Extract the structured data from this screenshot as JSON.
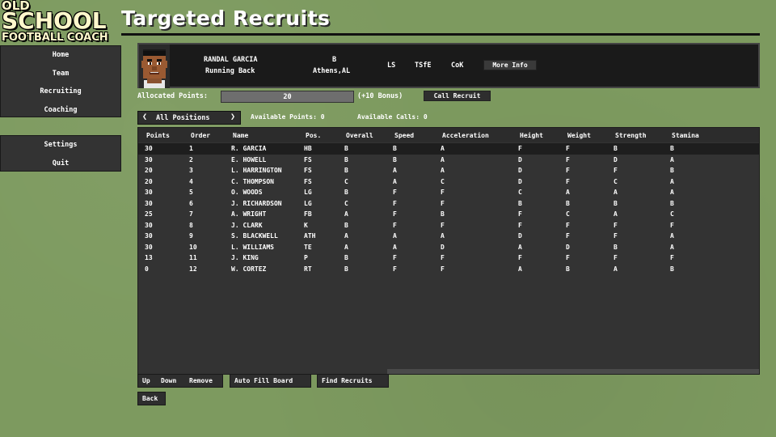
{
  "logo": {
    "line1": "OLD",
    "line2": "SCHOOL",
    "line3": "FOOTBALL COACH"
  },
  "sidebar": {
    "main_items": [
      {
        "label": "Home"
      },
      {
        "label": "Team"
      },
      {
        "label": "Recruiting"
      },
      {
        "label": "Coaching"
      }
    ],
    "bottom_items": [
      {
        "label": "Settings"
      },
      {
        "label": "Quit"
      }
    ]
  },
  "page": {
    "title": "Targeted Recruits"
  },
  "recruit": {
    "name": "RANDAL GARCIA",
    "position": "Running Back",
    "grade": "B",
    "hometown": "Athens,AL",
    "tag1": "LS",
    "tag2": "TSfE",
    "tag3": "CoK",
    "more_info_label": "More Info"
  },
  "allocation": {
    "label": "Allocated Points:",
    "value": "20",
    "bonus": "(+10 Bonus)",
    "call_button": "Call Recruit"
  },
  "filter": {
    "position_label": "All Positions",
    "available_points": "Available Points: 0",
    "available_calls": "Available Calls: 0"
  },
  "table": {
    "headers": [
      "Points",
      "Order",
      "Name",
      "Pos.",
      "Overall",
      "Speed",
      "Acceleration",
      "Height",
      "Weight",
      "Strength",
      "Stamina"
    ],
    "rows": [
      [
        "30",
        "1",
        "R. GARCIA",
        "HB",
        "B",
        "B",
        "A",
        "F",
        "F",
        "B",
        "B"
      ],
      [
        "30",
        "2",
        "E. HOWELL",
        "FS",
        "B",
        "B",
        "A",
        "D",
        "F",
        "D",
        "A"
      ],
      [
        "20",
        "3",
        "L. HARRINGTON",
        "FS",
        "B",
        "A",
        "A",
        "D",
        "F",
        "F",
        "B"
      ],
      [
        "20",
        "4",
        "C. THOMPSON",
        "FS",
        "C",
        "A",
        "C",
        "D",
        "F",
        "C",
        "A"
      ],
      [
        "30",
        "5",
        "O. WOODS",
        "LG",
        "B",
        "F",
        "F",
        "C",
        "A",
        "A",
        "A"
      ],
      [
        "30",
        "6",
        "J. RICHARDSON",
        "LG",
        "C",
        "F",
        "F",
        "B",
        "B",
        "B",
        "B"
      ],
      [
        "25",
        "7",
        "A. WRIGHT",
        "FB",
        "A",
        "F",
        "B",
        "F",
        "C",
        "A",
        "C"
      ],
      [
        "30",
        "8",
        "J. CLARK",
        "K",
        "B",
        "F",
        "F",
        "F",
        "F",
        "F",
        "F"
      ],
      [
        "30",
        "9",
        "S. BLACKWELL",
        "ATH",
        "A",
        "A",
        "A",
        "D",
        "F",
        "F",
        "A"
      ],
      [
        "30",
        "10",
        "L. WILLIAMS",
        "TE",
        "A",
        "A",
        "D",
        "A",
        "D",
        "B",
        "A"
      ],
      [
        "13",
        "11",
        "J. KING",
        "P",
        "B",
        "F",
        "F",
        "F",
        "F",
        "F",
        "F"
      ],
      [
        "0",
        "12",
        "W. CORTEZ",
        "RT",
        "B",
        "F",
        "F",
        "A",
        "B",
        "A",
        "B"
      ]
    ]
  },
  "actions": {
    "up": "Up",
    "down": "Down",
    "remove": "Remove",
    "auto_fill": "Auto Fill Board",
    "find_recruits": "Find Recruits",
    "back": "Back"
  },
  "colors": {
    "background": "#7d9a5f",
    "panel": "#333333",
    "selected_row": "#1e1e1e",
    "logo_text": "#fff8cc"
  }
}
